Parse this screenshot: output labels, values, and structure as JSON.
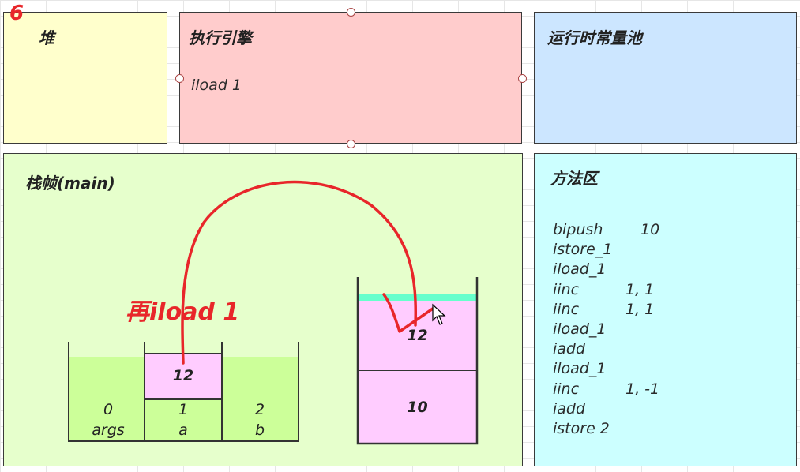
{
  "step_number": "6",
  "heap": {
    "title": "堆"
  },
  "engine": {
    "title": "执行引擎",
    "current_instruction": "iload 1"
  },
  "constant_pool": {
    "title": "运行时常量池"
  },
  "frame": {
    "title": "栈帧(main)"
  },
  "method_area": {
    "title": "方法区",
    "bytecode": [
      {
        "op": "bipush",
        "arg": "10"
      },
      {
        "op": "istore_1",
        "arg": ""
      },
      {
        "op": "iload_1",
        "arg": ""
      },
      {
        "op": "iinc",
        "arg": "1, 1"
      },
      {
        "op": "iinc",
        "arg": "1, 1"
      },
      {
        "op": "iload_1",
        "arg": ""
      },
      {
        "op": "iadd",
        "arg": ""
      },
      {
        "op": "iload_1",
        "arg": ""
      },
      {
        "op": "iinc",
        "arg": "1, -1"
      },
      {
        "op": "iadd",
        "arg": ""
      },
      {
        "op": "istore 2",
        "arg": ""
      }
    ]
  },
  "local_vars": [
    {
      "index": "0",
      "name": "args",
      "value": ""
    },
    {
      "index": "1",
      "name": "a",
      "value": "12"
    },
    {
      "index": "2",
      "name": "b",
      "value": ""
    }
  ],
  "operand_stack": [
    "12",
    "10"
  ],
  "annotation": "再iload 1",
  "colors": {
    "heap_bg": "#ffffcc",
    "engine_bg": "#ffcccc",
    "pool_bg": "#cce6ff",
    "frame_bg": "#e6ffcc",
    "method_bg": "#ccffff",
    "lv_fill": "#ccff99",
    "cell_pink": "#ffccff",
    "stack_top": "#66ffcc",
    "annotation_red": "#e8262a"
  }
}
